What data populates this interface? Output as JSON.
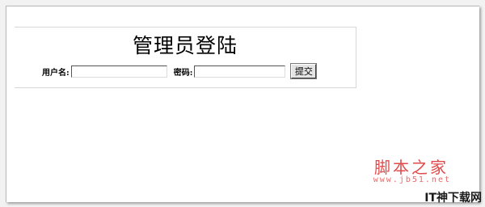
{
  "login": {
    "title": "管理员登陆",
    "username_label": "用户名:",
    "username_value": "",
    "password_label": "密码:",
    "password_value": "",
    "submit_label": "提交"
  },
  "watermark": {
    "site_name": "脚本之家",
    "site_url": "www.jb51.net"
  },
  "corner_mark": "IT神下载网"
}
